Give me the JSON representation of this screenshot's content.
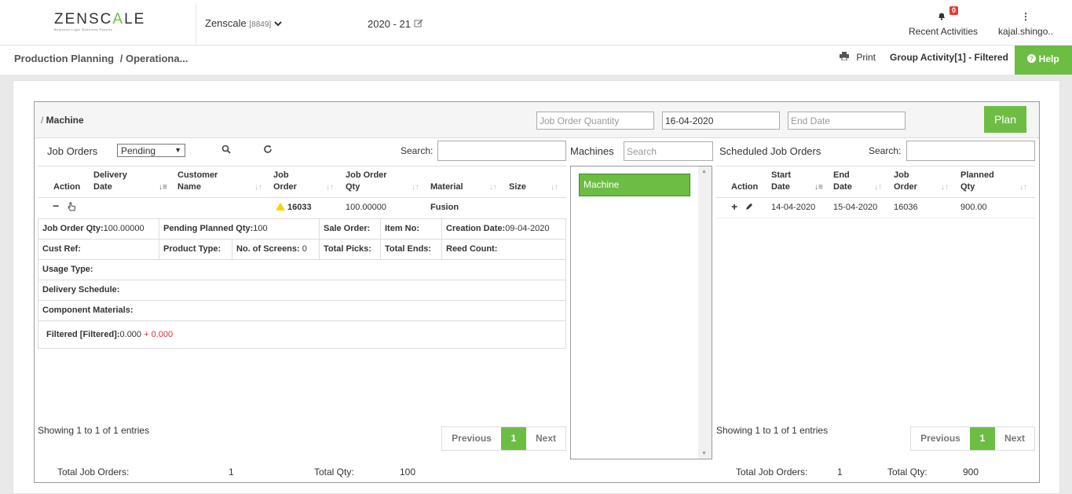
{
  "header": {
    "logo_left": "ZENSC",
    "logo_accent": "A",
    "logo_right": "LE",
    "logo_tagline": "Business Logic Business Results",
    "company": "Zenscale",
    "company_code": "[8849]",
    "year": "2020 - 21",
    "notifications_count": "0",
    "recent_label": "Recent Activities",
    "user": "kajal.shingo.."
  },
  "breadcrumb": {
    "part1": "Production Planning",
    "part2": "/ Operationa..."
  },
  "toolbar": {
    "print": "Print",
    "group_activity": "Group Activity[1] - Filtered",
    "help": "Help"
  },
  "panel": {
    "title_prefix": "/ ",
    "title": "Machine",
    "job_order_qty_placeholder": "Job Order Quantity",
    "start_date": "16-04-2020",
    "end_date_placeholder": "End Date",
    "plan": "Plan"
  },
  "job_orders": {
    "title": "Job Orders",
    "status": "Pending",
    "search_label": "Search:",
    "columns": {
      "action": "Action",
      "delivery_date_1": "Delivery",
      "delivery_date_2": "Date",
      "customer_name_1": "Customer",
      "customer_name_2": "Name",
      "job_order_1": "Job",
      "job_order_2": "Order",
      "job_order_qty_1": "Job Order",
      "job_order_qty_2": "Qty",
      "material": "Material",
      "size": "Size"
    },
    "row": {
      "action": "−",
      "job_order": "16033",
      "job_order_qty": "100.00000",
      "material": "Fusion"
    },
    "details": {
      "job_order_qty_label": "Job Order Qty:",
      "job_order_qty_value": "100.00000",
      "pending_planned_label": "Pending Planned Qty:",
      "pending_planned_value": "100",
      "sale_order_label": "Sale Order:",
      "item_no_label": "Item No:",
      "creation_date_label": "Creation Date:",
      "creation_date_value": "09-04-2020",
      "cust_ref_label": "Cust Ref:",
      "product_type_label": "Product Type:",
      "screens_label": "No. of Screens:",
      "screens_value": "0",
      "total_picks_label": "Total Picks:",
      "total_ends_label": "Total Ends:",
      "reed_count_label": "Reed Count:",
      "usage_type_label": "Usage Type:",
      "delivery_schedule_label": "Delivery Schedule:",
      "component_materials_label": "Component Materials:",
      "filtered_label": "Filtered [Filtered]:",
      "filtered_value": "0.000",
      "filtered_extra": "+ 0.000"
    },
    "showing": "Showing 1 to 1 of 1 entries",
    "pager": {
      "prev": "Previous",
      "page": "1",
      "next": "Next"
    },
    "total_label": "Total Job Orders:",
    "total_value": "1",
    "total_qty_label": "Total Qty:",
    "total_qty_value": "100"
  },
  "machines": {
    "title": "Machines",
    "search_placeholder": "Search",
    "items": [
      "Machine"
    ]
  },
  "scheduled": {
    "title": "Scheduled Job Orders",
    "search_label": "Search:",
    "columns": {
      "action": "Action",
      "start_date_1": "Start",
      "start_date_2": "Date",
      "end_date_1": "End",
      "end_date_2": "Date",
      "job_order_1": "Job",
      "job_order_2": "Order",
      "planned_qty_1": "Planned",
      "planned_qty_2": "Qty"
    },
    "row": {
      "start_date": "14-04-2020",
      "end_date": "15-04-2020",
      "job_order": "16036",
      "planned_qty": "900.00"
    },
    "showing": "Showing 1 to 1 of 1 entries",
    "pager": {
      "prev": "Previous",
      "page": "1",
      "next": "Next"
    },
    "total_label": "Total Job Orders:",
    "total_value": "1",
    "total_qty_label": "Total Qty:",
    "total_qty_value": "900"
  },
  "colors": {
    "accent": "#6dbd44",
    "alert": "#d9302e",
    "warning": "#f5d400"
  }
}
